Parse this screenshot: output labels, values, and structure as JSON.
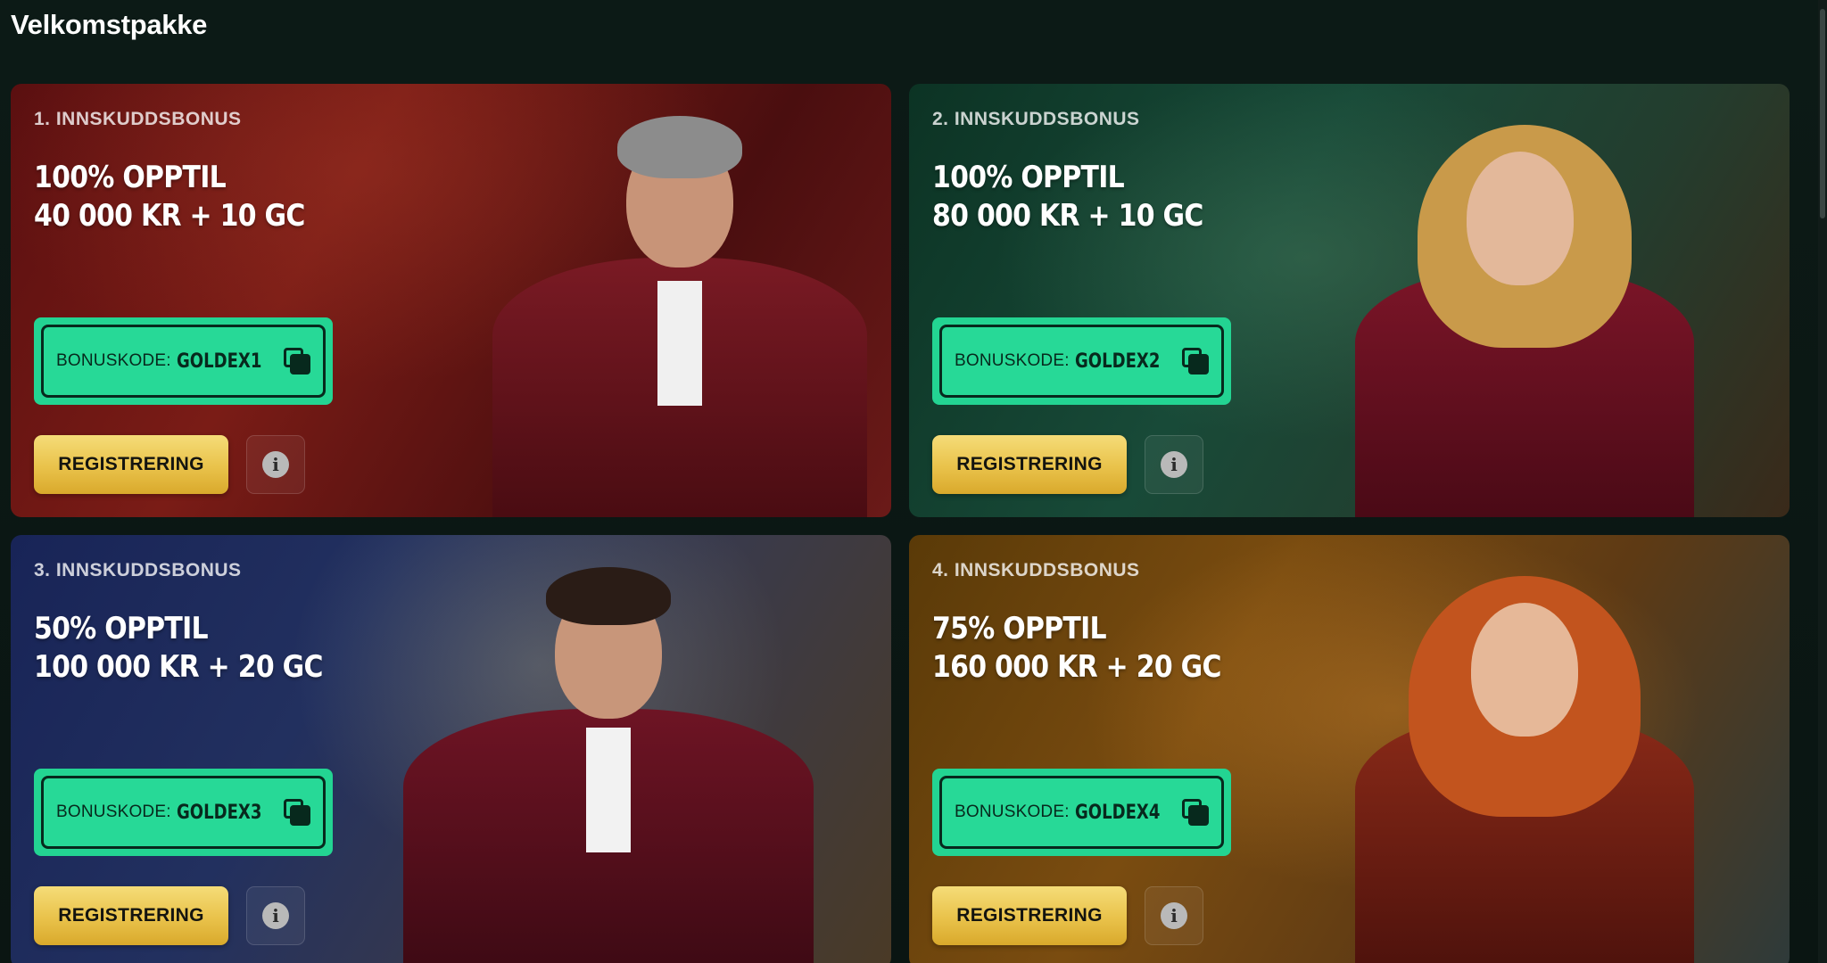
{
  "page": {
    "title": "Velkomstpakke"
  },
  "cards": [
    {
      "label": "1. INNSKUDDSBONUS",
      "offer_line1": "100% OPPTIL",
      "offer_line2": "40 000 KR + 10 GC",
      "code_prefix": "BONUSKODE:",
      "code": "GOLDEX1",
      "register_label": "REGISTRERING",
      "theme": "#6b1516"
    },
    {
      "label": "2. INNSKUDDSBONUS",
      "offer_line1": "100% OPPTIL",
      "offer_line2": "80 000 KR + 10 GC",
      "code_prefix": "BONUSKODE:",
      "code": "GOLDEX2",
      "register_label": "REGISTRERING",
      "theme": "#14402e"
    },
    {
      "label": "3. INNSKUDDSBONUS",
      "offer_line1": "50% OPPTIL",
      "offer_line2": "100 000 KR + 20 GC",
      "code_prefix": "BONUSKODE:",
      "code": "GOLDEX3",
      "register_label": "REGISTRERING",
      "theme": "#1e2a5c"
    },
    {
      "label": "4. INNSKUDDSBONUS",
      "offer_line1": "75% OPPTIL",
      "offer_line2": "160 000 KR + 20 GC",
      "code_prefix": "BONUSKODE:",
      "code": "GOLDEX4",
      "register_label": "REGISTRERING",
      "theme": "#6a420c"
    }
  ],
  "icons": {
    "copy": "copy-icon",
    "info": "info-icon",
    "info_glyph": "i"
  },
  "colors": {
    "code_box": "#23d492",
    "register_button": "#e9c24a",
    "background": "#0b1714"
  }
}
